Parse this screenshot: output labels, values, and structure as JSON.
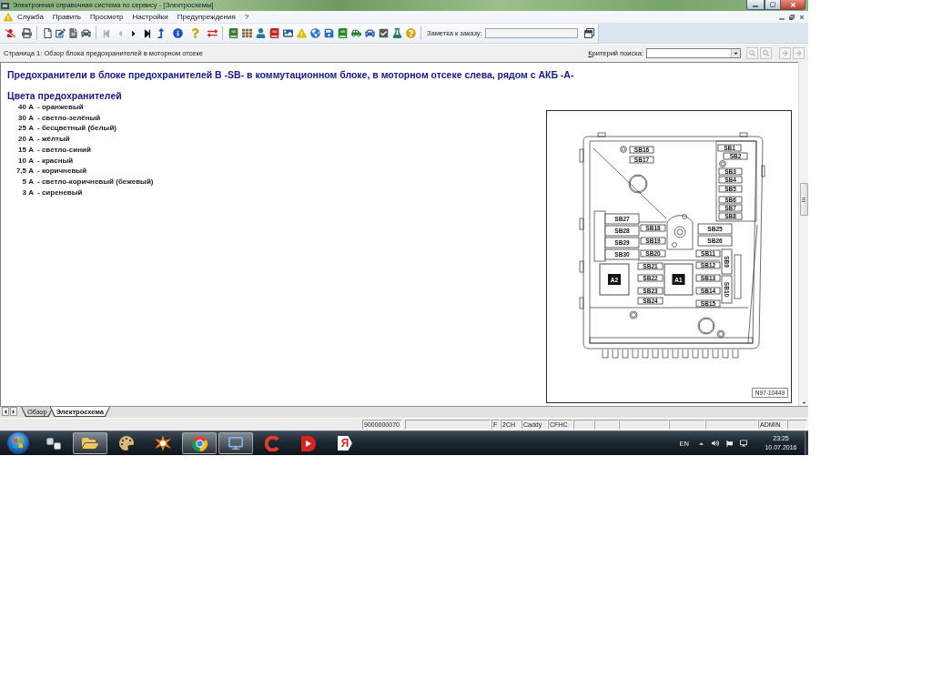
{
  "window": {
    "title": "Электронная справочная система по сервису - [Электросхемы]"
  },
  "menu": [
    "Служба",
    "Править",
    "Просмотр",
    "Настройки",
    "Предупреждения",
    "?"
  ],
  "toolbar": {
    "navigation": [
      {
        "disabled": true
      },
      {
        "disabled": true
      },
      {
        "disabled": false
      },
      {
        "disabled": false
      }
    ],
    "order_note": {
      "label": "Заметка к заказу:"
    }
  },
  "page_bar": {
    "title": "Страница 1: Обзор блока предохранителей в моторном отсеке",
    "search": {
      "label": "Критерий поиска:",
      "buttons": [
        {
          "disabled": true
        },
        {
          "disabled": true
        },
        {
          "disabled": true
        },
        {
          "disabled": true
        }
      ]
    }
  },
  "document": {
    "heading": "Предохранители в блоке предохранителей В -SB- в коммутационном блоке, в моторном отсеке слева, рядом с АКБ -А-",
    "section_title": "Цвета предохранителей",
    "fuse_colors": [
      {
        "rating": "40 А",
        "color_name": "- оранжевый"
      },
      {
        "rating": "30 А",
        "color_name": "- светло-зелёный"
      },
      {
        "rating": "25 А",
        "color_name": "- бесцветный (белый)"
      },
      {
        "rating": "20 А",
        "color_name": "- жёлтый"
      },
      {
        "rating": "15 А",
        "color_name": "- светло-синий"
      },
      {
        "rating": "10 А",
        "color_name": "- красный"
      },
      {
        "rating": "7,5 А",
        "color_name": "- коричневый"
      },
      {
        "rating": "5 А",
        "color_name": "- светло-коричневый (бежевый)"
      },
      {
        "rating": "3 А",
        "color_name": "- сиреневый"
      }
    ],
    "figure": {
      "fuses": [
        "SB16",
        "SB17",
        "SB1",
        "SB2",
        "SB3",
        "SB4",
        "SB5",
        "SB6",
        "SB7",
        "SB8",
        "SB27",
        "SB28",
        "SB29",
        "SB30",
        "SB18",
        "SB19",
        "SB20",
        "SB25",
        "SB26",
        "SB21",
        "SB22",
        "SB23",
        "SB24",
        "SB11",
        "SB12",
        "SB13",
        "SB14",
        "SB15",
        "SB9",
        "SB10"
      ],
      "modules": [
        "A2",
        "A1"
      ],
      "code": "N97-10449"
    }
  },
  "tabs": [
    {
      "label": "Обзор",
      "selected": false
    },
    {
      "label": "Электросхема",
      "selected": true
    }
  ],
  "status_bar": [
    "9000000070",
    "F",
    "2CH",
    "Caddy",
    "CFHC",
    "ADMIN"
  ],
  "taskbar": {
    "apps": [
      {
        "kind": "keys",
        "running": false
      },
      {
        "kind": "folder",
        "running": true
      },
      {
        "kind": "palette",
        "running": false
      },
      {
        "kind": "antivirus",
        "running": false
      },
      {
        "kind": "browser",
        "running": true
      },
      {
        "kind": "app",
        "running": true
      },
      {
        "kind": "cleaner",
        "running": false
      },
      {
        "kind": "player",
        "running": false
      },
      {
        "kind": "letter",
        "running": false,
        "letter": "Я"
      }
    ],
    "language": "EN",
    "time": "23:25",
    "date": "10.07.2016"
  }
}
